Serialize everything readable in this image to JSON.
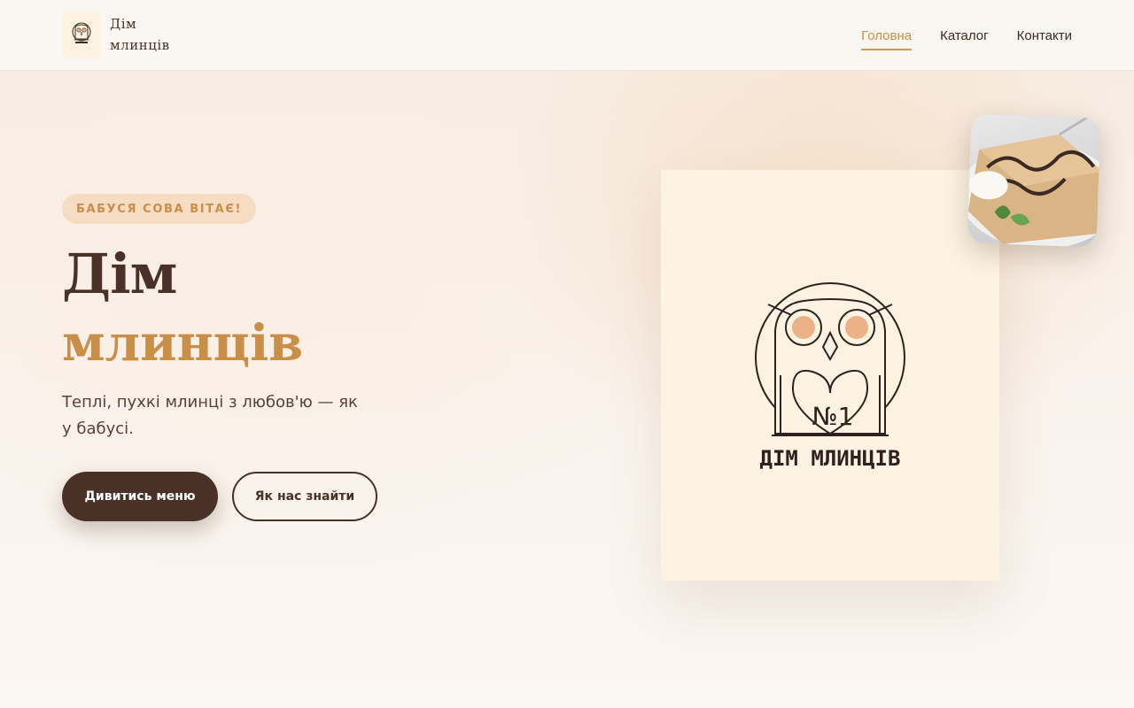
{
  "header": {
    "brand_line1": "Дім",
    "brand_line2": "млинців",
    "nav": [
      {
        "label": "Головна",
        "active": true
      },
      {
        "label": "Каталог",
        "active": false
      },
      {
        "label": "Контакти",
        "active": false
      }
    ]
  },
  "hero": {
    "badge": "БАБУСЯ СОВА ВІТАЄ!",
    "title_line1": "Дім",
    "title_line2": "млинців",
    "subtitle": "Теплі, пухкі млинці з любов'ю — як у бабусі.",
    "primary_button": "Дивитись меню",
    "secondary_button": "Як нас знайти"
  },
  "logo_card": {
    "logo_number": "№1",
    "logo_caption": "ДІМ МЛИНЦІВ"
  },
  "colors": {
    "accent": "#c98e47",
    "dark": "#4a3128",
    "badge_bg": "#f5dcc3",
    "card_bg": "#fdf3e2"
  },
  "icons": [
    "owl-logo-icon",
    "pancake-photo"
  ]
}
